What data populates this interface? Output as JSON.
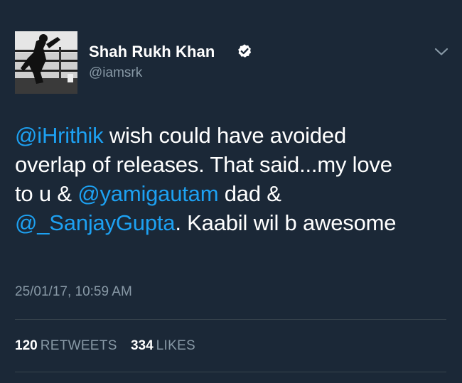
{
  "author": {
    "name": "Shah Rukh Khan",
    "handle": "@iamsrk",
    "verified": true
  },
  "tweet": {
    "lines": [
      [
        {
          "text": "@iHrithik",
          "mention": true
        },
        {
          "text": " wish could have avoided",
          "mention": false
        }
      ],
      [
        {
          "text": "overlap of releases. That said...my love",
          "mention": false
        }
      ],
      [
        {
          "text": "to u & ",
          "mention": false
        },
        {
          "text": "@yamigautam",
          "mention": true
        },
        {
          "text": " dad &",
          "mention": false
        }
      ],
      [
        {
          "text": "@_SanjayGupta",
          "mention": true
        },
        {
          "text": ". Kaabil wil b awesome",
          "mention": false
        }
      ]
    ],
    "timestamp": "25/01/17, 10:59 AM"
  },
  "stats": {
    "retweets": {
      "count": "120",
      "label": "RETWEETS"
    },
    "likes": {
      "count": "334",
      "label": "LIKES"
    }
  },
  "colors": {
    "background": "#1b2837",
    "mention": "#1da1f2",
    "secondary_text": "#8899a6",
    "divider": "#38444d"
  },
  "icons": {
    "verified": "verified-badge-icon",
    "menu": "chevron-down-icon"
  }
}
